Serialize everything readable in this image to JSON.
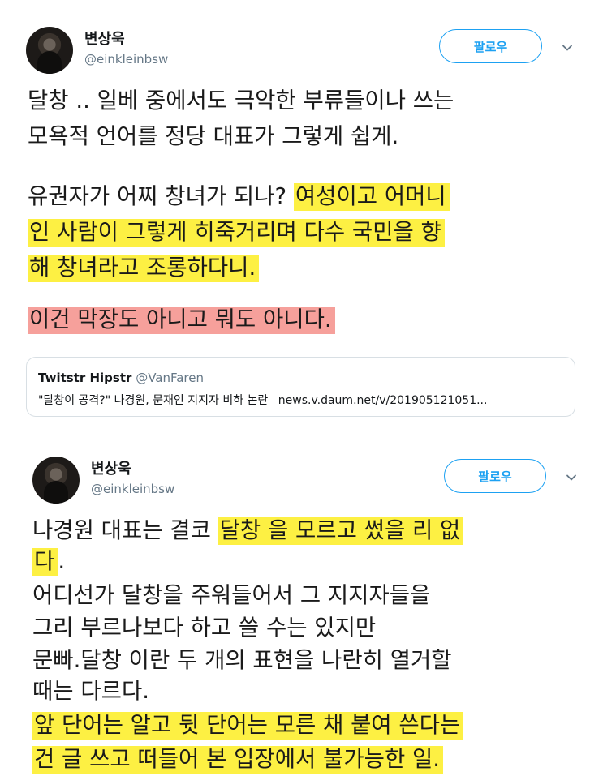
{
  "tweets": [
    {
      "author": {
        "name": "변상욱",
        "handle": "@einkleinbsw"
      },
      "follow_label": "팔로우",
      "lines": [
        {
          "segments": [
            {
              "text": "달창 .. 일베 중에서도 극악한 부류들이나 쓰는",
              "hl": ""
            }
          ]
        },
        {
          "segments": [
            {
              "text": "모욕적 언어를  정당 대표가 그렇게 쉽게.",
              "hl": ""
            }
          ]
        },
        {
          "segments": [
            {
              "text": "유권자가 어찌 창녀가 되나? ",
              "hl": ""
            },
            {
              "text": "여성이고 어머니",
              "hl": "y"
            }
          ]
        },
        {
          "segments": [
            {
              "text": "인 사람이 그렇게 히죽거리며 다수 국민을 향",
              "hl": "y"
            }
          ]
        },
        {
          "segments": [
            {
              "text": "해 창녀라고 조롱하다니.",
              "hl": "y"
            }
          ]
        },
        {
          "segments": [
            {
              "text": "이건 막장도 아니고 뭐도 아니다.",
              "hl": "r"
            }
          ]
        }
      ],
      "quote": {
        "name": "Twitstr Hipstr",
        "handle": "@VanFaren",
        "text": "\"달창이 공격?\" 나경원, 문재인 지지자 비하 논란",
        "link": "news.v.daum.net/v/201905121051..."
      }
    },
    {
      "author": {
        "name": "변상욱",
        "handle": "@einkleinbsw"
      },
      "follow_label": "팔로우",
      "lines": [
        {
          "segments": [
            {
              "text": "나경원 대표는 결코 ",
              "hl": ""
            },
            {
              "text": "달창 을 모르고 썼을 리 없",
              "hl": "y"
            }
          ]
        },
        {
          "segments": [
            {
              "text": "다",
              "hl": "y"
            },
            {
              "text": ".",
              "hl": ""
            }
          ]
        },
        {
          "segments": [
            {
              "text": " 어디선가 달창을 주워들어서 그 지지자들을",
              "hl": ""
            }
          ]
        },
        {
          "segments": [
            {
              "text": "그리 부르나보다  하고 쓸 수는 있지만",
              "hl": ""
            }
          ]
        },
        {
          "segments": [
            {
              "text": "문빠.달창 이란 두 개의 표현을 나란히 열거할",
              "hl": ""
            }
          ]
        },
        {
          "segments": [
            {
              "text": "때는 다르다.",
              "hl": ""
            }
          ]
        },
        {
          "segments": [
            {
              "text": "앞 단어는 알고 뒷 단어는 모른 채 붙여 쓴다는",
              "hl": "y"
            }
          ]
        },
        {
          "segments": [
            {
              "text": "건 글 쓰고 떠들어 본 입장에서 불가능한 일.",
              "hl": "y"
            }
          ]
        }
      ]
    }
  ]
}
